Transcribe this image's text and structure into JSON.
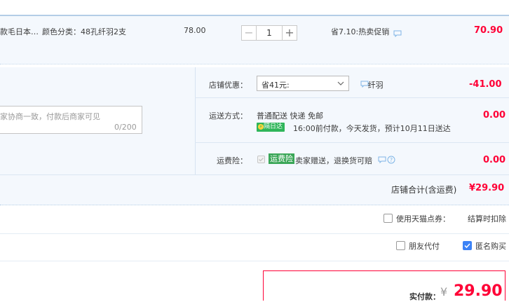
{
  "item": {
    "title": "款毛日本…",
    "sku": "颜色分类：48孔纤羽2支",
    "price": "78.00",
    "quantity": "1",
    "promo": "省7.10:热卖促销",
    "subtotal": "70.90"
  },
  "shop": {
    "discount_label": "店铺优惠：",
    "discount_value": "省41元:                                纤羽",
    "discount_amount": "-41.00",
    "message_placeholder": "家协商一致，付款后商家可见",
    "message_count": "0/200",
    "shipping_label": "运送方式：",
    "shipping_method": "普通配送 快递 免邮",
    "shipping_badge": "隔日达",
    "shipping_detail": "16:00前付款，今天发货，预计10月11日送达",
    "shipping_amount": "0.00",
    "insurance_label": "运费险：",
    "insurance_badge": "运费险",
    "insurance_text": "卖家赠送，退换货可赔",
    "insurance_amount": "0.00",
    "total_label": "店铺合计(含运费)",
    "total_value": "¥29.90"
  },
  "options": {
    "tmall_points": "使用天猫点券：",
    "checkout_deduct": "结算时扣除",
    "friend_pay": "朋友代付",
    "anonymous": "匿名购买"
  },
  "footer": {
    "pay_label": "实付款：",
    "currency": "¥",
    "pay_amount": "29.90"
  },
  "colors": {
    "accent_red": "#ff0036",
    "link_blue": "#3b82f6",
    "badge_green": "#2fb55a"
  }
}
